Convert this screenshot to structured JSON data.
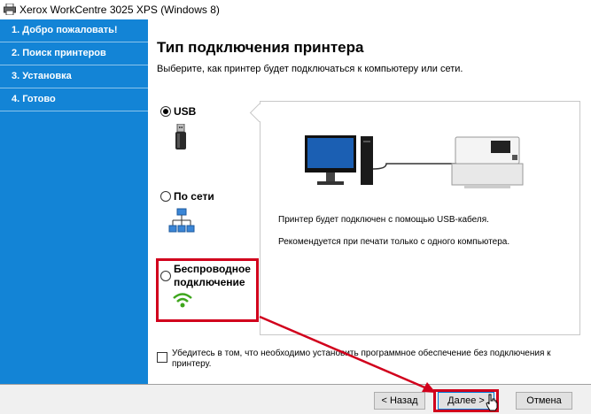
{
  "window": {
    "title": "Xerox WorkCentre 3025 XPS (Windows 8)"
  },
  "sidebar": {
    "steps": [
      {
        "label": "1. Добро пожаловать!"
      },
      {
        "label": "2. Поиск принтеров"
      },
      {
        "label": "3. Установка"
      },
      {
        "label": "4. Готово"
      }
    ]
  },
  "main": {
    "heading": "Тип подключения принтера",
    "subheading": "Выберите, как принтер будет подключаться к компьютеру или сети.",
    "options": [
      {
        "label": "USB",
        "icon": "usb-icon",
        "selected": true
      },
      {
        "label": "По сети",
        "icon": "network-icon",
        "selected": false
      },
      {
        "label_line1": "Беспроводное",
        "label_line2": "подключение",
        "icon": "wifi-icon",
        "selected": false
      }
    ],
    "panel": {
      "description": "Принтер будет подключен с помощью USB-кабеля.",
      "recommendation": "Рекомендуется при печати только с одного компьютера."
    },
    "confirm_text": "Убедитесь в том, что необходимо установить программное обеспечение без подключения к принтеру."
  },
  "footer": {
    "back_label": "< Назад",
    "next_label": "Далее >",
    "cancel_label": "Отмена"
  },
  "colors": {
    "sidebar": "#1384d6",
    "highlight": "#d1001c",
    "arrow": "#d1001c",
    "wifi": "#3ea61c"
  }
}
